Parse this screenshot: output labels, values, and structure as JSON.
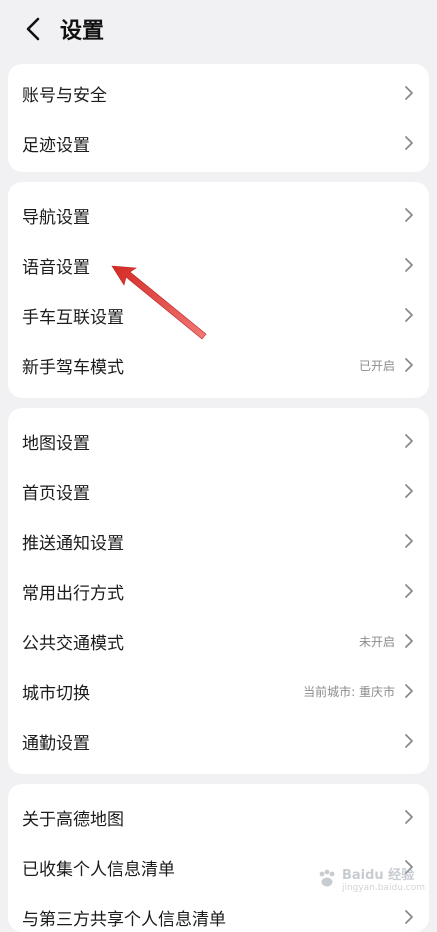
{
  "header": {
    "title": "设置",
    "back_icon": "chevron-left-icon"
  },
  "groups": [
    {
      "items": [
        {
          "label": "账号与安全"
        },
        {
          "label": "足迹设置"
        }
      ]
    },
    {
      "items": [
        {
          "label": "导航设置"
        },
        {
          "label": "语音设置"
        },
        {
          "label": "手车互联设置"
        },
        {
          "label": "新手驾车模式",
          "value": "已开启"
        }
      ]
    },
    {
      "items": [
        {
          "label": "地图设置"
        },
        {
          "label": "首页设置"
        },
        {
          "label": "推送通知设置"
        },
        {
          "label": "常用出行方式"
        },
        {
          "label": "公共交通模式",
          "value": "未开启"
        },
        {
          "label": "城市切换",
          "value": "当前城市: 重庆市"
        },
        {
          "label": "通勤设置"
        }
      ]
    },
    {
      "items": [
        {
          "label": "关于高德地图"
        },
        {
          "label": "已收集个人信息清单"
        },
        {
          "label": "与第三方共享个人信息清单"
        }
      ]
    }
  ],
  "annotation": {
    "color": "#e0332f",
    "points_to": "语音设置"
  },
  "watermark": {
    "text": "Baidu 经验",
    "sub": "jingyan.baidu.com"
  }
}
